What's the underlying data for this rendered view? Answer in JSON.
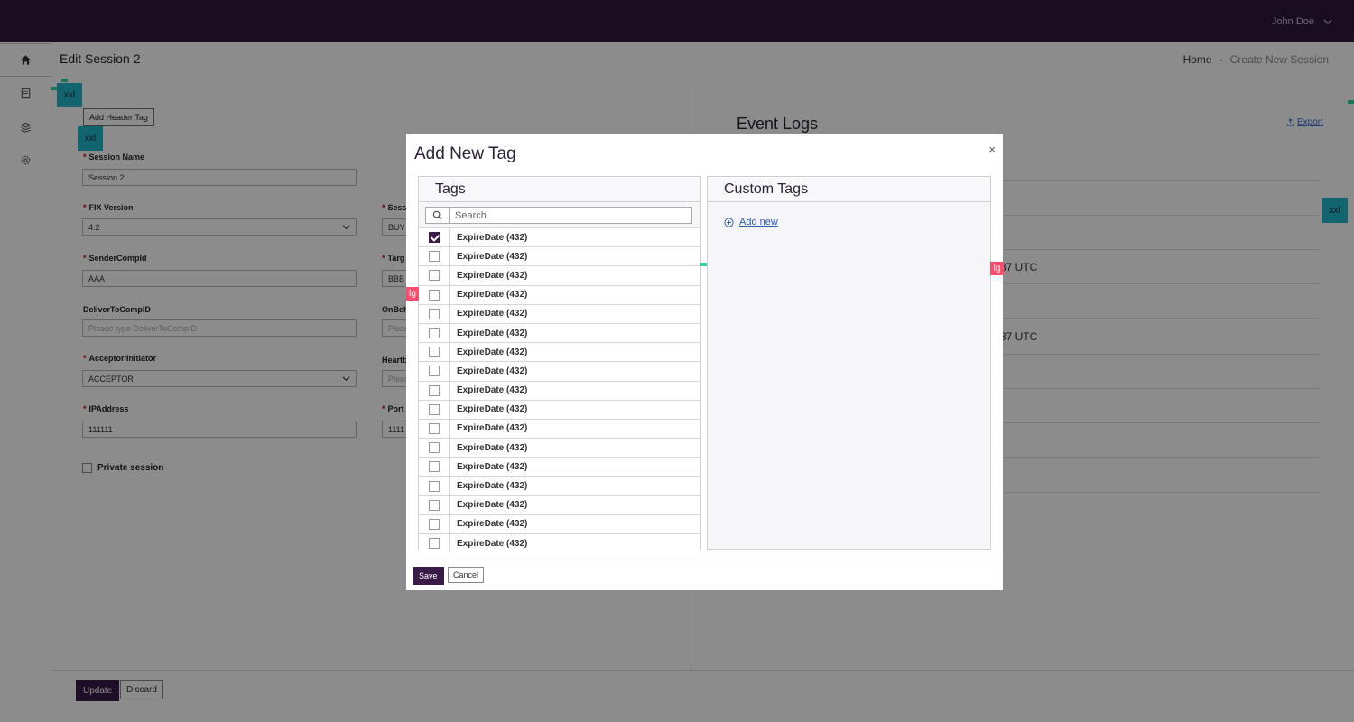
{
  "header": {
    "user_name": "John Doe"
  },
  "page": {
    "title": "Edit Session 2"
  },
  "breadcrumb": {
    "home": "Home",
    "separator": "-",
    "current": "Create New Session"
  },
  "debug_badges": {
    "xxl": "xxl",
    "lg": "lg"
  },
  "form": {
    "add_header_tag": "Add Header Tag",
    "session_name": {
      "label": "Session Name",
      "value": "Session 2"
    },
    "fix_version": {
      "label": "FIX Version",
      "value": "4.2"
    },
    "session_side": {
      "label": "Sess",
      "value": "BUY"
    },
    "sender_comp_id": {
      "label": "SenderCompId",
      "value": "AAA"
    },
    "target_comp_id": {
      "label": "Targ",
      "value": "BBB"
    },
    "deliver_to_comp_id": {
      "label": "DeliverToCompID",
      "placeholder": "Please type DeliverToCompID"
    },
    "on_behalf": {
      "label": "OnBeh",
      "placeholder": "Pleas"
    },
    "acceptor_initiator": {
      "label": "Acceptor/Initiator",
      "value": "ACCEPTOR"
    },
    "heartbeat": {
      "label": "Heartb",
      "placeholder": "Pleas"
    },
    "ip_address": {
      "label": "IPAddress",
      "value": "111111"
    },
    "port": {
      "label": "Port",
      "value": "1111"
    },
    "private_session": "Private session"
  },
  "event_logs": {
    "title": "Event Logs",
    "export": "Export",
    "time_1": "37 UTC",
    "time_2": "37 UTC"
  },
  "footer": {
    "update": "Update",
    "discard": "Discard"
  },
  "modal": {
    "title": "Add New Tag",
    "close": "×",
    "tags_heading": "Tags",
    "custom_tags_heading": "Custom Tags",
    "search_placeholder": "Search",
    "add_new": "Add new",
    "save": "Save",
    "cancel": "Cancel",
    "tags": [
      {
        "label": "ExpireDate (432)",
        "checked": true
      },
      {
        "label": "ExpireDate (432)",
        "checked": false
      },
      {
        "label": "ExpireDate (432)",
        "checked": false
      },
      {
        "label": "ExpireDate (432)",
        "checked": false
      },
      {
        "label": "ExpireDate (432)",
        "checked": false
      },
      {
        "label": "ExpireDate (432)",
        "checked": false
      },
      {
        "label": "ExpireDate (432)",
        "checked": false
      },
      {
        "label": "ExpireDate (432)",
        "checked": false
      },
      {
        "label": "ExpireDate (432)",
        "checked": false
      },
      {
        "label": "ExpireDate (432)",
        "checked": false
      },
      {
        "label": "ExpireDate (432)",
        "checked": false
      },
      {
        "label": "ExpireDate (432)",
        "checked": false
      },
      {
        "label": "ExpireDate (432)",
        "checked": false
      },
      {
        "label": "ExpireDate (432)",
        "checked": false
      },
      {
        "label": "ExpireDate (432)",
        "checked": false
      },
      {
        "label": "ExpireDate (432)",
        "checked": false
      },
      {
        "label": "ExpireDate (432)",
        "checked": false
      }
    ]
  }
}
